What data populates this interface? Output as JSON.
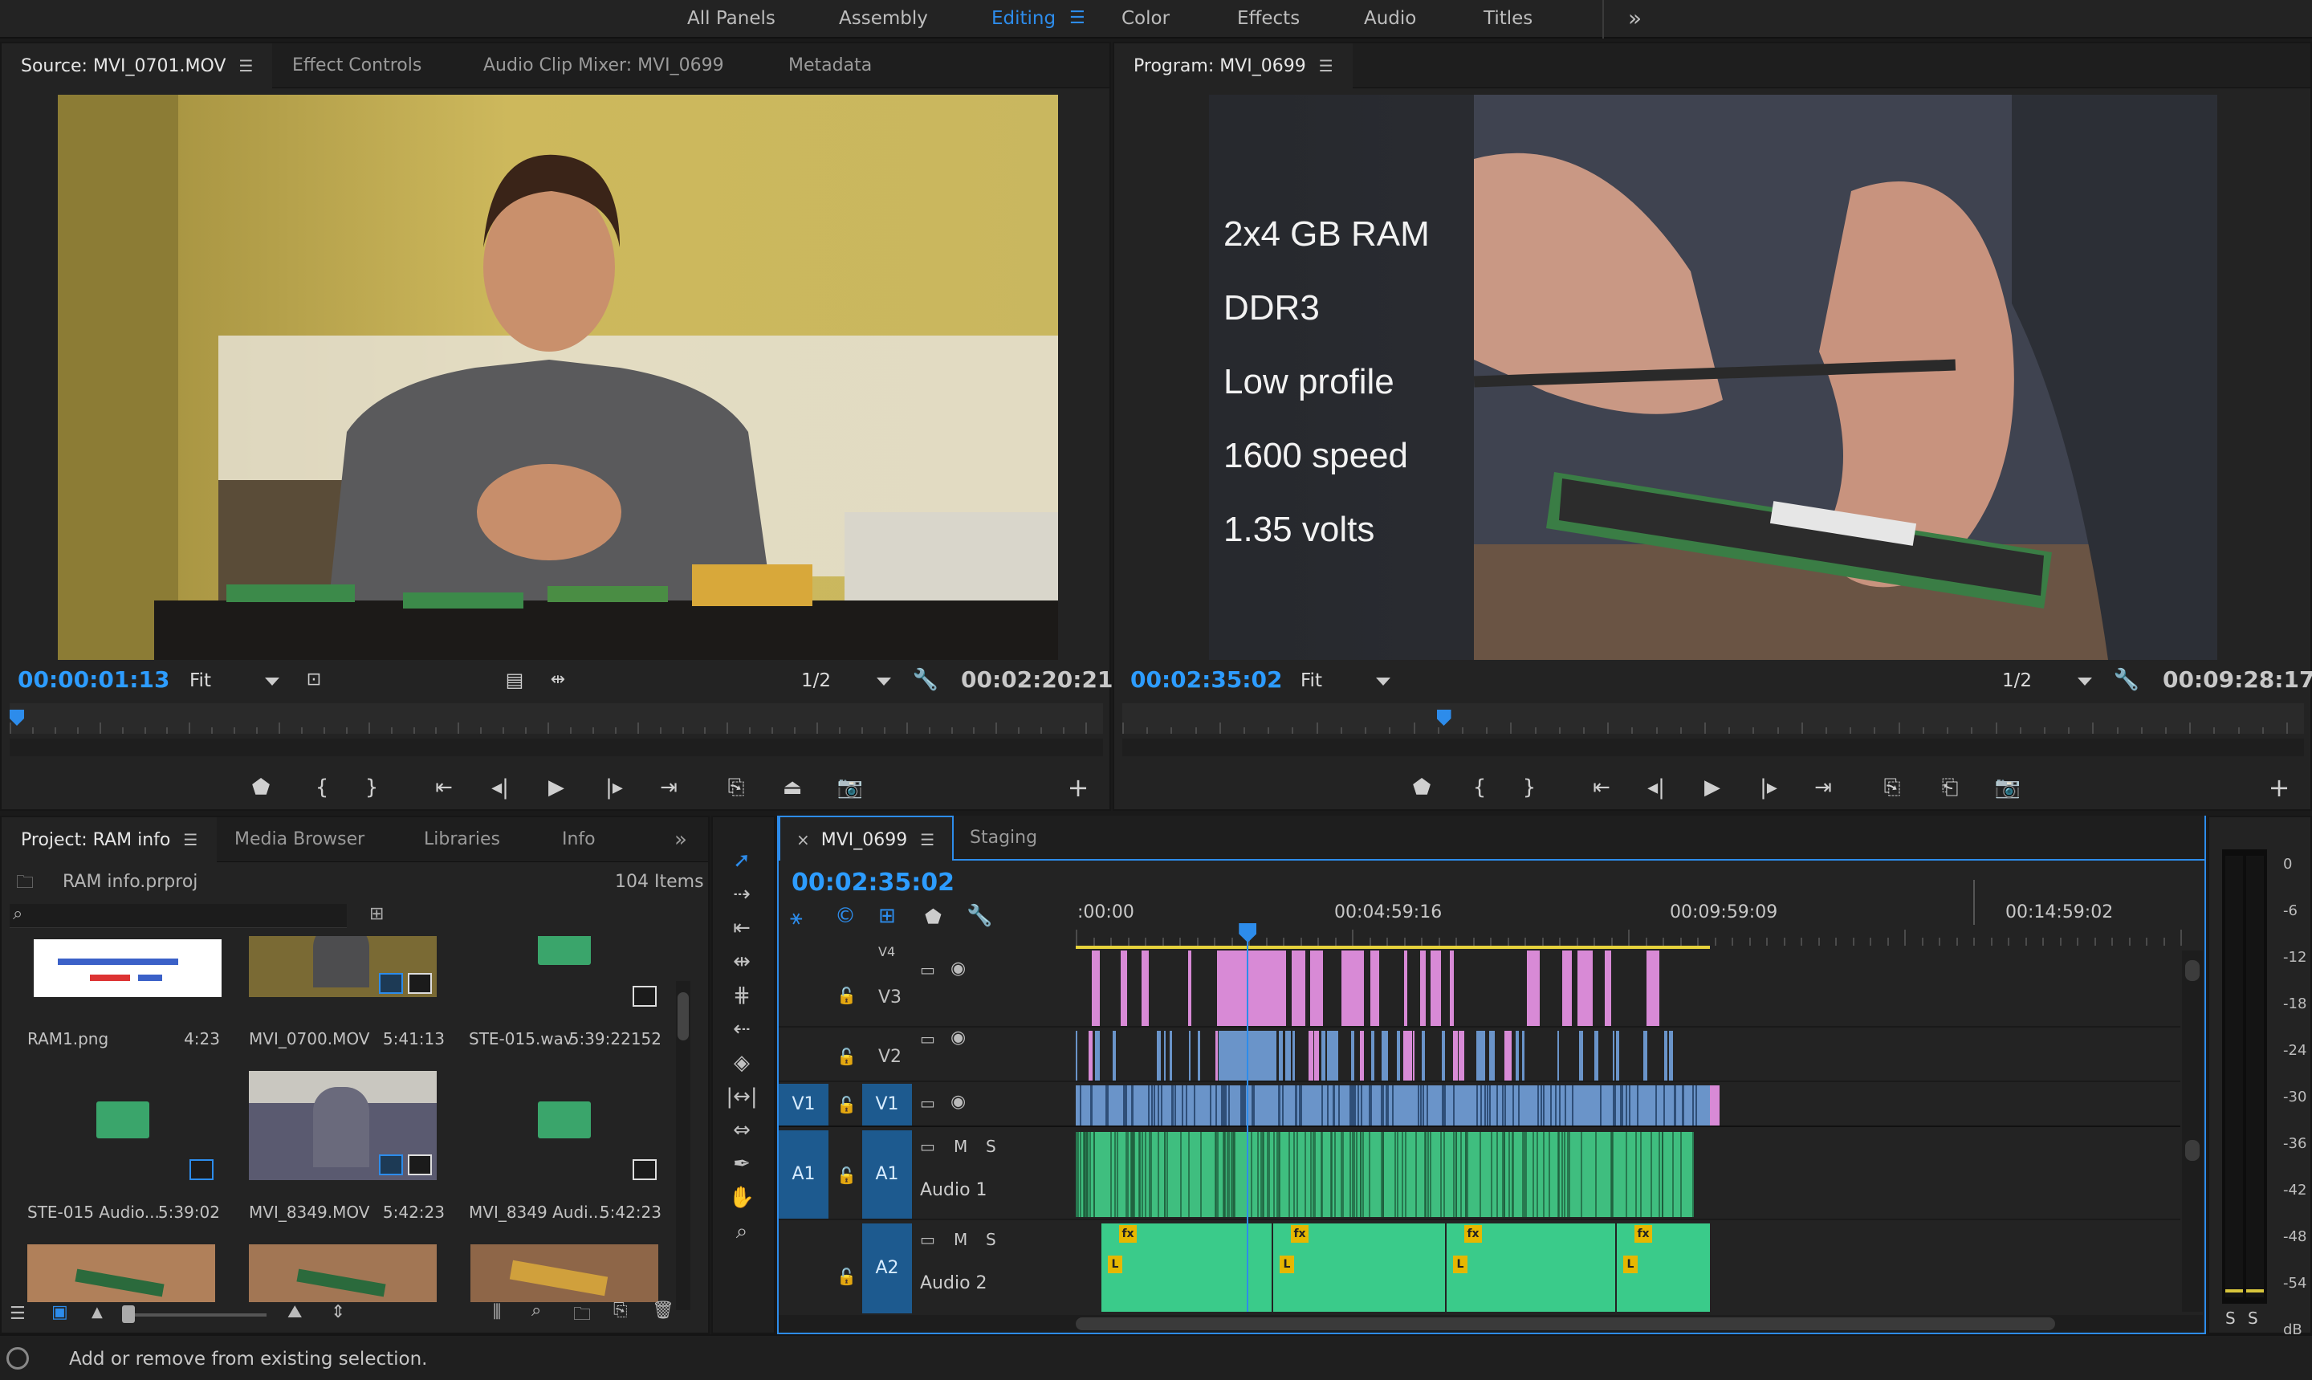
{
  "workspace": {
    "tabs": [
      "All Panels",
      "Assembly",
      "Editing",
      "Color",
      "Effects",
      "Audio",
      "Titles"
    ],
    "active": "Editing",
    "more_label": "»"
  },
  "source_monitor": {
    "tabs": [
      "Source: MVI_0701.MOV",
      "Effect Controls",
      "Audio Clip Mixer: MVI_0699",
      "Metadata"
    ],
    "timecode": "00:00:01:13",
    "fit": "Fit",
    "resolution": "1/2",
    "duration": "00:02:20:21",
    "playhead_fraction": 0.0
  },
  "program_monitor": {
    "tab": "Program: MVI_0699",
    "timecode": "00:02:35:02",
    "fit": "Fit",
    "resolution": "1/2",
    "duration": "00:09:28:17",
    "playhead_fraction": 0.27,
    "overlay_lines": [
      "2x4 GB RAM",
      "DDR3",
      "Low profile",
      "1600 speed",
      "1.35 volts"
    ]
  },
  "project": {
    "tabs": [
      "Project: RAM info",
      "Media Browser",
      "Libraries",
      "Info"
    ],
    "file": "RAM info.prproj",
    "item_count": "104 Items",
    "items": [
      {
        "name": "RAM1.png",
        "duration": "4:23",
        "kind": "image"
      },
      {
        "name": "MVI_0700.MOV",
        "duration": "5:41:13",
        "kind": "video"
      },
      {
        "name": "STE-015.wav",
        "duration": "5:39:22152",
        "kind": "audio"
      },
      {
        "name": "STE-015 Audio...",
        "duration": "5:39:02",
        "kind": "audio"
      },
      {
        "name": "MVI_8349.MOV",
        "duration": "5:42:23",
        "kind": "video"
      },
      {
        "name": "MVI_8349 Audi...",
        "duration": "5:42:23",
        "kind": "audio"
      },
      {
        "name": "",
        "duration": "",
        "kind": "video"
      },
      {
        "name": "",
        "duration": "",
        "kind": "video"
      },
      {
        "name": "",
        "duration": "",
        "kind": "video"
      }
    ]
  },
  "timeline": {
    "tabs": [
      "MVI_0699",
      "Staging"
    ],
    "close_label": "×",
    "timecode": "00:02:35:02",
    "ruler_labels": [
      ":00:00",
      "00:04:59:16",
      "00:09:59:09",
      "00:14:59:02"
    ],
    "playhead_fraction": 0.155,
    "tracks": {
      "v4": "V4",
      "v3": "V3",
      "v2": "V2",
      "v1": "V1",
      "a1": "A1",
      "a2": "A2",
      "a1_name": "Audio 1",
      "a2_name": "Audio 2",
      "mute": "M",
      "solo": "S",
      "fx_label": "fx",
      "l_label": "L"
    }
  },
  "meter": {
    "scale": [
      "0",
      "-6",
      "-12",
      "-18",
      "-24",
      "-30",
      "-36",
      "-42",
      "-48",
      "-54",
      "dB"
    ],
    "solo_labels": [
      "S",
      "S"
    ]
  },
  "status_bar": {
    "message": "Add or remove from existing selection."
  },
  "colors": {
    "accent": "#2d8ceb",
    "video_clip": "#6a94c9",
    "pink_clip": "#d88ad6",
    "audio_clip": "#3fbe7f"
  }
}
